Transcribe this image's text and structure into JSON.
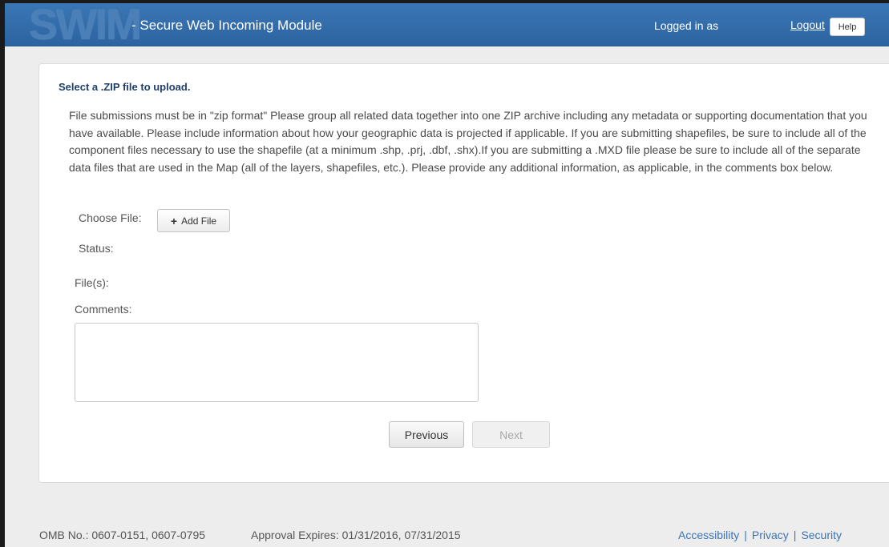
{
  "header": {
    "logo_text": "SWIM",
    "subtitle": "- Secure Web Incoming Module",
    "logged_in_text": "Logged in as",
    "logout_label": "Logout",
    "help_label": "Help"
  },
  "main": {
    "title": "Select a .ZIP file to upload.",
    "instructions": "File submissions must be in \"zip format\" Please group all related data together into one ZIP archive including any metadata or supporting documentation that you have available. Please include information about how your geographic data is projected if applicable. If you are submitting shapefiles, be sure to include all of the component files necessary to use the shapefile (at a minimum .shp, .prj, .dbf, .shx).If you are submitting a .MXD file please be sure to include all of the separate data files that are used in the Map (all of the layers, shapefiles, etc.). Please provide any additional information, as applicable, in the comments box below.",
    "choose_file_label": "Choose File:",
    "add_file_label": "Add File",
    "status_label": "Status:",
    "files_label": "File(s):",
    "comments_label": "Comments:",
    "comments_value": "",
    "previous_label": "Previous",
    "next_label": "Next"
  },
  "footer": {
    "omb": "OMB No.: 0607-0151, 0607-0795",
    "approval": "Approval Expires: 01/31/2016, 07/31/2015",
    "links": [
      "Accessibility",
      "Privacy",
      "Security"
    ],
    "separator": "|"
  },
  "colors": {
    "navbar": "#2f68a6",
    "link": "#3a74b8",
    "title": "#1f3f6b"
  },
  "icons": {
    "add_file": "plus-icon"
  }
}
